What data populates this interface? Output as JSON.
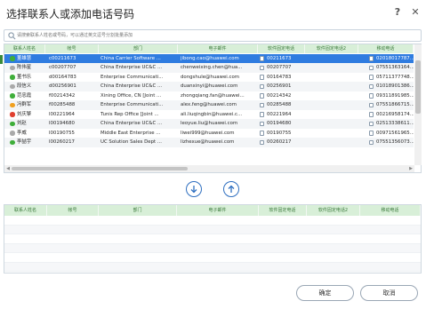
{
  "window": {
    "title": "选择联系人或添加电话号码",
    "help_icon": "?",
    "close_icon": "✕"
  },
  "search": {
    "placeholder": "请搜索联系人姓名或号码，可以通过英文逗号分割批量添加"
  },
  "columns": [
    "联系人姓名",
    "帐号",
    "部门",
    "电子邮件",
    "软件固定电话",
    "软件固定电话2",
    "移动电话"
  ],
  "top_list": {
    "selected_index": 0,
    "rows": [
      {
        "name": "董雄慧",
        "account": "c00211673",
        "dept": "China Carrier Software ...",
        "email": "jibong.cao@huawei.com",
        "soft_phone": "00211673",
        "soft_phone2": "",
        "mobile": "02018017787...",
        "status": "online"
      },
      {
        "name": "陈伟星",
        "account": "c00207707",
        "dept": "China Enterprise UC&C ...",
        "email": "chenweixing.chen@hua...",
        "soft_phone": "00207707",
        "soft_phone2": "",
        "mobile": "07551363164...",
        "status": "offline"
      },
      {
        "name": "董书乐",
        "account": "d00164783",
        "dept": "Enterprise Communicati...",
        "email": "dongshule@huawei.com",
        "soft_phone": "00164783",
        "soft_phone2": "",
        "mobile": "05711377748...",
        "status": "online"
      },
      {
        "name": "段信义",
        "account": "d00256901",
        "dept": "China Enterprise UC&C ...",
        "email": "duanxinyi@huawei.com",
        "soft_phone": "00256901",
        "soft_phone2": "",
        "mobile": "01018901386...",
        "status": "offline"
      },
      {
        "name": "范忠霞",
        "account": "f00214342",
        "dept": "Xining Office, CN [Joint ...",
        "email": "zhongqiang.fan@huawei...",
        "soft_phone": "00214342",
        "soft_phone2": "",
        "mobile": "09311891985...",
        "status": "online"
      },
      {
        "name": "冯群军",
        "account": "f00285488",
        "dept": "Enterprise Communicati...",
        "email": "alex.feng@huawei.com",
        "soft_phone": "00285488",
        "soft_phone2": "",
        "mobile": "07551866715...",
        "status": "away"
      },
      {
        "name": "刘庆擎",
        "account": "l00221964",
        "dept": "Tunis Rep Office [Joint ...",
        "email": "ali.liuqingbin@huawei.c...",
        "soft_phone": "00221964",
        "soft_phone2": "",
        "mobile": "00216958174...",
        "status": "busy"
      },
      {
        "name": "刘赵",
        "account": "l00194680",
        "dept": "China Enterprise UC&C ...",
        "email": "leoyue.liu@huawei.com",
        "soft_phone": "00194680",
        "soft_phone2": "",
        "mobile": "02513338611...",
        "status": "online"
      },
      {
        "name": "李威",
        "account": "l00190755",
        "dept": "Middle East Enterprise ...",
        "email": "liwei999@huawei.com",
        "soft_phone": "00190755",
        "soft_phone2": "",
        "mobile": "00971561965...",
        "status": "offline"
      },
      {
        "name": "李喆宇",
        "account": "l00260217",
        "dept": "UC Solution Sales Dept ...",
        "email": "lizhexue@huawei.com",
        "soft_phone": "00260217",
        "soft_phone2": "",
        "mobile": "07551356073...",
        "status": "online"
      }
    ]
  },
  "bottom_list": {
    "rows": []
  },
  "actions": {
    "move_down_icon": "arrow-down-icon",
    "move_up_icon": "arrow-up-icon",
    "ok_label": "确定",
    "cancel_label": "取消"
  },
  "colors": {
    "accent": "#2f7ce0",
    "header_bg": "#d8efd8",
    "header_text": "#3a7a3a",
    "online": "#3fae3a",
    "offline": "#a9a9a9",
    "away": "#f0a020",
    "busy": "#e04030"
  }
}
